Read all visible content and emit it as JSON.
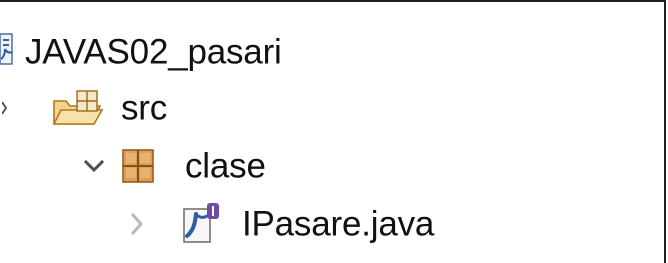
{
  "tree": {
    "project": {
      "label": "JAVAS02_pasari",
      "icon": "java-project-icon"
    },
    "source_folder": {
      "label": "src",
      "icon": "source-folder-icon",
      "toggle": "collapsed-arrow-icon"
    },
    "package": {
      "label": "clase",
      "icon": "package-icon",
      "toggle": "chevron-down-icon"
    },
    "file": {
      "label": "IPasare.java",
      "icon": "java-interface-file-icon",
      "toggle": "chevron-right-icon"
    }
  }
}
